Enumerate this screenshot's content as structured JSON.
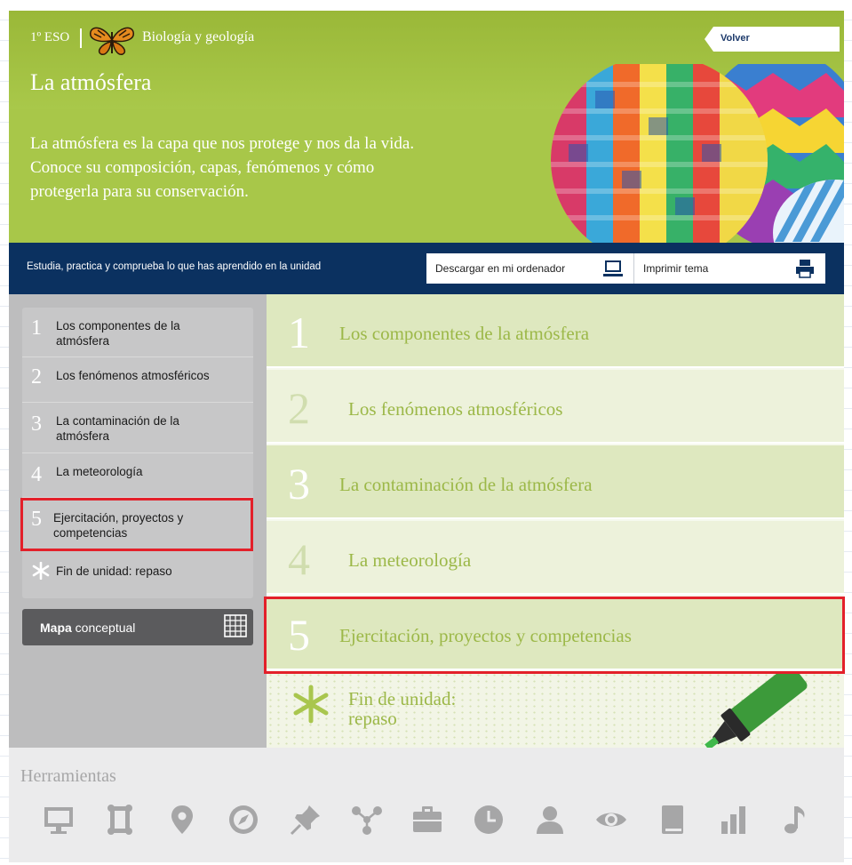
{
  "header": {
    "grade": "1º ESO",
    "subject": "Biología y geología",
    "title": "La atmósfera",
    "description": "La atmósfera es la capa que nos protege y nos da la vida. Conoce su composición, capas, fenómenos y cómo protegerla para su conservación.",
    "back_label": "Volver"
  },
  "bar": {
    "tagline": "Estudia, practica y comprueba lo que has aprendido en la unidad",
    "download_label": "Descargar en mi ordenador",
    "print_label": "Imprimir tema"
  },
  "sidebar": {
    "items": [
      {
        "num": "1",
        "label": "Los componentes de la atmósfera"
      },
      {
        "num": "2",
        "label": "Los fenómenos atmosféricos"
      },
      {
        "num": "3",
        "label": "La contaminación de la atmósfera"
      },
      {
        "num": "4",
        "label": "La meteorología"
      },
      {
        "num": "5",
        "label": "Ejercitación, proyectos y competencias"
      },
      {
        "num": "*",
        "label": "Fin de unidad: repaso"
      }
    ],
    "mapa_bold": "Mapa",
    "mapa_rest": " conceptual"
  },
  "content": {
    "rows": [
      {
        "num": "1",
        "label": "Los componentes de la atmósfera"
      },
      {
        "num": "2",
        "label": "Los fenómenos atmosféricos"
      },
      {
        "num": "3",
        "label": "La contaminación de la atmósfera"
      },
      {
        "num": "4",
        "label": "La meteorología"
      },
      {
        "num": "5",
        "label": "Ejercitación, proyectos y competencias"
      }
    ],
    "fin_line1": "Fin de unidad:",
    "fin_line2": "repaso"
  },
  "tools": {
    "title": "Herramientas",
    "icons": [
      "monitor-icon",
      "frame-icon",
      "map-pin-icon",
      "compass-icon",
      "pushpin-icon",
      "share-nodes-icon",
      "briefcase-icon",
      "clock-icon",
      "user-icon",
      "eye-icon",
      "book-icon",
      "bar-chart-icon",
      "music-note-icon"
    ]
  },
  "colors": {
    "header_green": "#a8c749",
    "nav_blue": "#0b3160",
    "content_text_green": "#9cb848",
    "highlight_red": "#e3202a",
    "tool_icon_gray": "#a6a6a7"
  }
}
